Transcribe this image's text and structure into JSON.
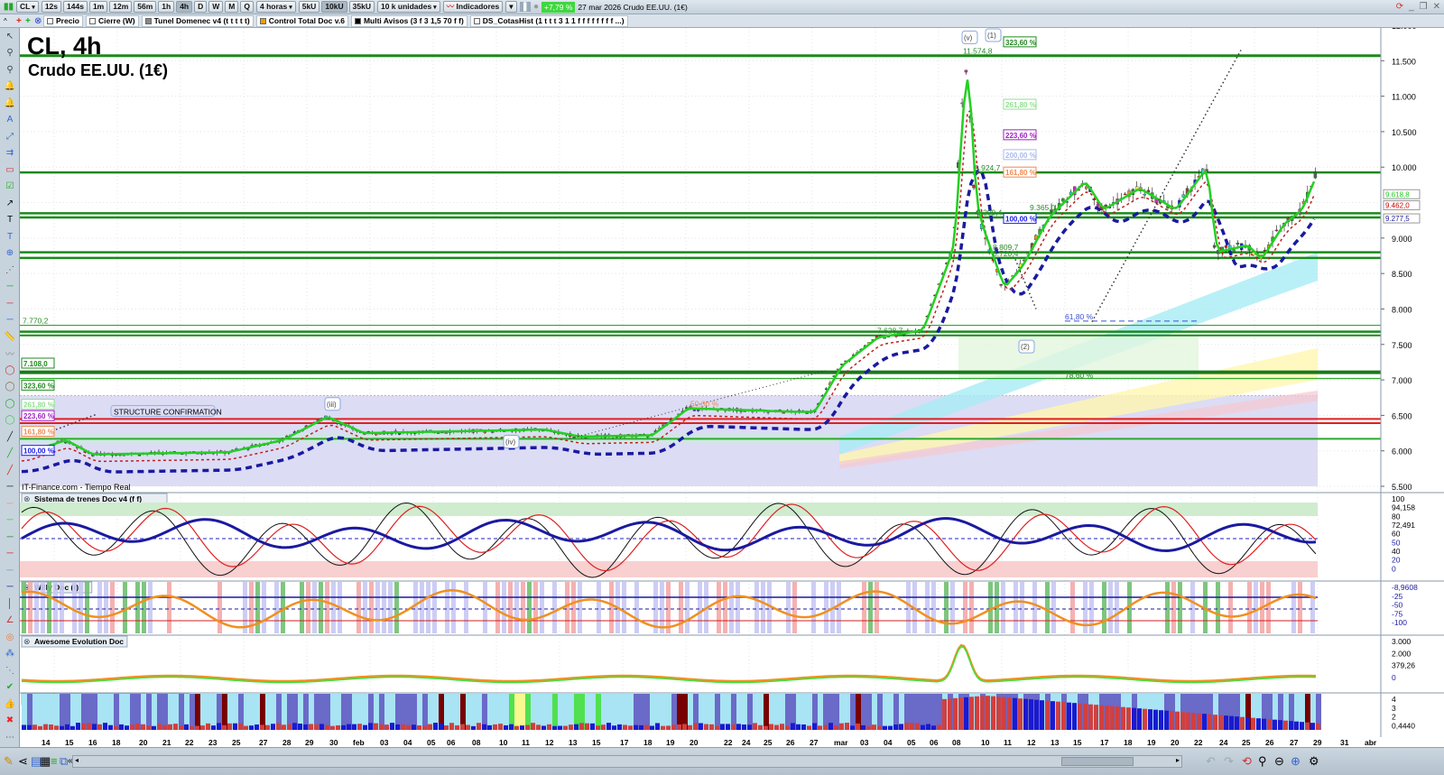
{
  "toolbar": {
    "symbol": "CL",
    "intervals": [
      "12s",
      "144s",
      "1m",
      "12m",
      "56m",
      "1h",
      "4h",
      "D",
      "W",
      "M",
      "Q"
    ],
    "active_interval": "4h",
    "period_select": "4 horas",
    "units_buttons": [
      "5kU",
      "10kU",
      "35kU"
    ],
    "active_unit": "10kU",
    "units_select": "10 k unidades",
    "indicators_label": "Indicadores",
    "change_badge": "+7,79 %",
    "header_info": "27 mar 2026 Crudo EE.UU. (1€)"
  },
  "legend_bar": [
    "Precio",
    "Cierre (W)",
    "Tunel Domenec v4 (t t t t t)",
    "Control Total Doc v.6",
    "Multi Avisos (3 f 3 1,5 70 f f)",
    "DS_CotasHist (1 t t t 3 1 1 f f f f f f f f ...)"
  ],
  "chart": {
    "title": "CL, 4h",
    "subtitle": "Crudo EE.UU. (1€)",
    "source": "IT-Finance.com - Tiempo Real",
    "price_axis": [
      "12.000",
      "11.500",
      "11.000",
      "10.500",
      "10.000",
      "9.000",
      "8.500",
      "8.000",
      "7.500",
      "7.000",
      "6.500",
      "6.000",
      "5.500"
    ],
    "price_tags": [
      {
        "text": "9.618,8",
        "color": "#22cc22",
        "price": 9618
      },
      {
        "text": "9.462,0",
        "color": "#cc0000",
        "price": 9462
      },
      {
        "text": "9.277,5",
        "color": "#1a1aa0",
        "price": 9277
      }
    ],
    "annotations": [
      {
        "text": "11.574,8",
        "color": "#2a8a2a",
        "price": 11574,
        "at": "1067"
      },
      {
        "text": "9.924,7",
        "color": "#2a8a2a",
        "price": 9924,
        "at": "1080"
      },
      {
        "text": "9.299,4",
        "color": "#2a8a2a",
        "price": 9299,
        "at": "1082"
      },
      {
        "text": "9.365,0",
        "color": "#2a8a2a",
        "price": 9365,
        "at": "1141"
      },
      {
        "text": "8.809,7",
        "color": "#2a8a2a",
        "price": 8809,
        "at": "1100"
      },
      {
        "text": "8.720,4",
        "color": "#2a8a2a",
        "price": 8720,
        "at": "1100"
      },
      {
        "text": "7.628,7",
        "color": "#2a8a2a",
        "price": 7628,
        "at": "972"
      },
      {
        "text": "7.770,2",
        "color": "#2a8a2a",
        "price": 7770,
        "at": "25"
      },
      {
        "text": "61,80 %",
        "color": "#3b4fd6",
        "price": 7830,
        "at": "1180"
      },
      {
        "text": "50,00 %",
        "color": "#f08a50",
        "price": 6600,
        "at": "765"
      },
      {
        "text": "78,60 %",
        "color": "#2a8a2a",
        "price": 7000,
        "at": "1180"
      }
    ],
    "fib_boxes": [
      {
        "text": "323,60 %",
        "color": "#1f8a1f",
        "price": 11760,
        "at": "1112"
      },
      {
        "text": "261,80 %",
        "color": "#8fe08f",
        "price": 10880,
        "at": "1112"
      },
      {
        "text": "223,60 %",
        "color": "#a020c0",
        "price": 10450,
        "at": "1112"
      },
      {
        "text": "200,00 %",
        "color": "#aabbee",
        "price": 10170,
        "at": "1112"
      },
      {
        "text": "161,80 %",
        "color": "#f08a50",
        "price": 9924,
        "at": "1112"
      },
      {
        "text": "100,00 %",
        "color": "#1a1aee",
        "price": 9270,
        "at": "1112"
      },
      {
        "text": "7.108,0",
        "color": "#1f8a1f",
        "price": 7230,
        "at": "24"
      },
      {
        "text": "323,60 %",
        "color": "#1f8a1f",
        "price": 6920,
        "at": "24"
      },
      {
        "text": "261,80 %",
        "color": "#8fe08f",
        "price": 6650,
        "at": "24"
      },
      {
        "text": "223,60 %",
        "color": "#a020c0",
        "price": 6490,
        "at": "24"
      },
      {
        "text": "161,80 %",
        "color": "#f08a50",
        "price": 6270,
        "at": "24"
      },
      {
        "text": "100,00 %",
        "color": "#1a1aee",
        "price": 6000,
        "at": "24"
      }
    ],
    "wave_labels": [
      {
        "text": "(v)",
        "price": 11830,
        "at": "1066"
      },
      {
        "text": "(1)",
        "price": 11860,
        "at": "1092"
      },
      {
        "text": "(2)",
        "price": 7470,
        "at": "1129"
      },
      {
        "text": "(iii)",
        "price": 6660,
        "at": "360"
      },
      {
        "text": "(iv)",
        "price": 6130,
        "at": "558"
      }
    ],
    "structure_label": "STRUCTURE CONFIRMATION"
  },
  "panels": [
    {
      "title": "Sistema de trenes Doc v4 (f f)",
      "axis": [
        "100",
        "94,158",
        "80",
        "72,491",
        "60",
        "50",
        "40",
        "20",
        "0"
      ]
    },
    {
      "title": "Willy Doc (t)",
      "axis": [
        "-8,9608",
        "-25",
        "-50",
        "-75",
        "-100"
      ]
    },
    {
      "title": "Awesome Evolution Doc",
      "axis": [
        "3.000",
        "2.000",
        "379,26",
        "0"
      ]
    },
    {
      "title": "Barra Fuerza Fondo Mercado v4 (f f)",
      "axis": [
        "4",
        "3",
        "2",
        "0,4440"
      ]
    }
  ],
  "date_axis": [
    "14",
    "15",
    "16",
    "18",
    "20",
    "21",
    "22",
    "23",
    "25",
    "27",
    "28",
    "29",
    "30",
    "feb",
    "03",
    "04",
    "05",
    "06",
    "08",
    "10",
    "11",
    "12",
    "13",
    "15",
    "17",
    "18",
    "19",
    "20",
    "22",
    "24",
    "25",
    "26",
    "27",
    "mar",
    "03",
    "04",
    "05",
    "06",
    "08",
    "10",
    "11",
    "12",
    "13",
    "15",
    "17",
    "18",
    "19",
    "20",
    "22",
    "24",
    "25",
    "26",
    "27",
    "29",
    "31",
    "abr"
  ],
  "price_path": [
    [
      22,
      5950
    ],
    [
      70,
      6150
    ],
    [
      100,
      5950
    ],
    [
      250,
      5980
    ],
    [
      310,
      6150
    ],
    [
      360,
      6480
    ],
    [
      400,
      6250
    ],
    [
      600,
      6300
    ],
    [
      640,
      6200
    ],
    [
      720,
      6220
    ],
    [
      760,
      6600
    ],
    [
      880,
      6550
    ],
    [
      900,
      6550
    ],
    [
      930,
      7200
    ],
    [
      970,
      7600
    ],
    [
      1020,
      7700
    ],
    [
      1055,
      8900
    ],
    [
      1065,
      11000
    ],
    [
      1070,
      11500
    ],
    [
      1078,
      9600
    ],
    [
      1085,
      9200
    ],
    [
      1110,
      8300
    ],
    [
      1130,
      8600
    ],
    [
      1160,
      9300
    ],
    [
      1200,
      9800
    ],
    [
      1220,
      9400
    ],
    [
      1260,
      9700
    ],
    [
      1300,
      9400
    ],
    [
      1335,
      10000
    ],
    [
      1345,
      8800
    ],
    [
      1380,
      8900
    ],
    [
      1395,
      8700
    ],
    [
      1420,
      9200
    ],
    [
      1440,
      9400
    ],
    [
      1458,
      9950
    ]
  ],
  "levels": [
    {
      "price": 11570,
      "color": "#1a8a1a",
      "w": 3
    },
    {
      "price": 9925,
      "color": "#1a8a1a",
      "w": 2.5
    },
    {
      "price": 9350,
      "color": "#1a8a1a",
      "w": 2.5
    },
    {
      "price": 9290,
      "color": "#1a8a1a",
      "w": 2.5
    },
    {
      "price": 8800,
      "color": "#1a8a1a",
      "w": 2.5
    },
    {
      "price": 8720,
      "color": "#1a8a1a",
      "w": 2.5
    },
    {
      "price": 7770,
      "color": "#2ea82e",
      "w": 1.2
    },
    {
      "price": 7680,
      "color": "#1a8a1a",
      "w": 2.5
    },
    {
      "price": 7628,
      "color": "#1a8a1a",
      "w": 2
    },
    {
      "price": 7108,
      "color": "#1a7a1a",
      "w": 4
    },
    {
      "price": 7020,
      "color": "#2ea82e",
      "w": 1.2
    },
    {
      "price": 6450,
      "color": "#e02020",
      "w": 2
    },
    {
      "price": 6390,
      "color": "#e02020",
      "w": 2
    },
    {
      "price": 6170,
      "color": "#2ea82e",
      "w": 2
    }
  ]
}
